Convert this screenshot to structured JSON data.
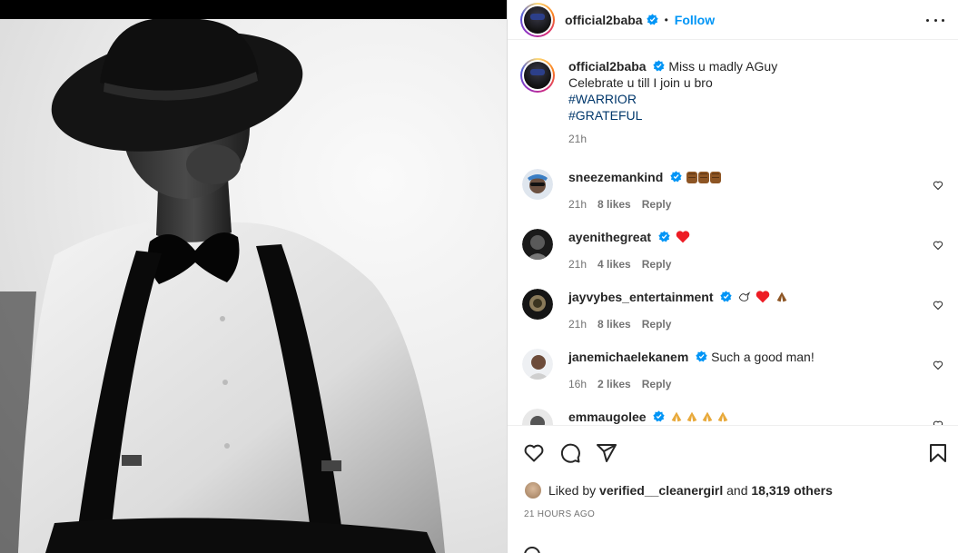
{
  "post": {
    "author": "official2baba",
    "follow_label": "Follow",
    "dot": "•"
  },
  "caption": {
    "author": "official2baba",
    "line1": "Miss u madly AGuy",
    "line2": "Celebrate u till I join u bro",
    "hashtags": [
      "#WARRIOR",
      "#GRATEFUL"
    ],
    "time": "21h"
  },
  "comments": [
    {
      "user": "sneezemankind",
      "text": "",
      "emoji": "fists",
      "time": "21h",
      "likes": "8 likes",
      "reply": "Reply"
    },
    {
      "user": "ayenithegreat",
      "text": "",
      "emoji": "red-heart",
      "time": "21h",
      "likes": "4 likes",
      "reply": "Reply"
    },
    {
      "user": "jayvybes_entertainment",
      "text": "",
      "emoji": "dove-heart-pray",
      "time": "21h",
      "likes": "8 likes",
      "reply": "Reply"
    },
    {
      "user": "janemichaelekanem",
      "text": "Such a good man!",
      "emoji": "",
      "time": "16h",
      "likes": "2 likes",
      "reply": "Reply"
    },
    {
      "user": "emmaugolee",
      "text": "",
      "emoji": "pray-x4",
      "time": "",
      "likes": "",
      "reply": ""
    }
  ],
  "likes": {
    "prefix": "Liked by",
    "user": "verified__cleanergirl",
    "and": "and",
    "others": "18,319 others"
  },
  "time_ago": "21 HOURS AGO",
  "colors": {
    "follow": "#0095f6",
    "hashtag": "#00376b",
    "verified": "#0095f6",
    "heart_red": "#ed1c24"
  }
}
